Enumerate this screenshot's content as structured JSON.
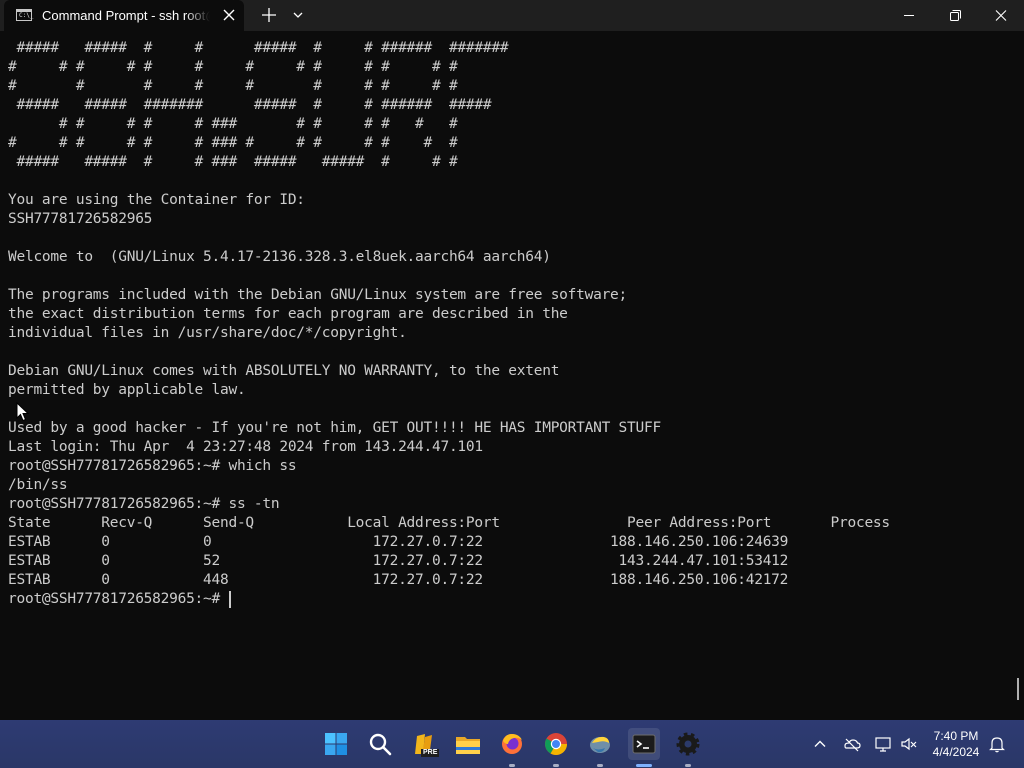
{
  "window": {
    "tab_title": "Command Prompt - ssh  root@",
    "tab_icon_text": "C:\\_"
  },
  "terminal": {
    "lines": [
      " #####   #####  #     #      #####  #     # ######  #######",
      "#     # #     # #     #     #     # #     # #     # #",
      "#       #       #     #     #       #     # #     # #",
      " #####   #####  #######      #####  #     # ######  #####",
      "      # #     # #     # ###       # #     # #   #   #",
      "#     # #     # #     # ### #     # #     # #    #  #",
      " #####   #####  #     # ###  #####   #####  #     # #",
      "",
      "You are using the Container for ID:",
      "SSH77781726582965",
      "",
      "Welcome to  (GNU/Linux 5.4.17-2136.328.3.el8uek.aarch64 aarch64)",
      "",
      "The programs included with the Debian GNU/Linux system are free software;",
      "the exact distribution terms for each program are described in the",
      "individual files in /usr/share/doc/*/copyright.",
      "",
      "Debian GNU/Linux comes with ABSOLUTELY NO WARRANTY, to the extent",
      "permitted by applicable law.",
      "",
      "Used by a good hacker - If you're not him, GET OUT!!!! HE HAS IMPORTANT STUFF",
      "Last login: Thu Apr  4 23:27:48 2024 from 143.244.47.101",
      "root@SSH77781726582965:~# which ss",
      "/bin/ss",
      "root@SSH77781726582965:~# ss -tn",
      "State      Recv-Q      Send-Q           Local Address:Port               Peer Address:Port       Process",
      "ESTAB      0           0                   172.27.0.7:22               188.146.250.106:24639",
      "ESTAB      0           52                  172.27.0.7:22                143.244.47.101:53412",
      "ESTAB      0           448                 172.27.0.7:22               188.146.250.106:42172",
      "root@SSH77781726582965:~# "
    ]
  },
  "taskbar": {
    "icons": [
      "windows-start-icon",
      "search-icon",
      "sticky-notes-pre-icon",
      "file-explorer-icon",
      "firefox-icon",
      "chrome-icon",
      "python-idle-icon",
      "terminal-icon",
      "settings-gear-icon"
    ],
    "sticky_badge": "PRE",
    "clock_time": "7:40 PM",
    "clock_date": "4/4/2024"
  },
  "colors": {
    "terminal_bg": "#0c0c0c",
    "terminal_fg": "#cccccc",
    "titlebar_bg": "#1f1f1f",
    "taskbar_bg": "#2b3a6a"
  }
}
